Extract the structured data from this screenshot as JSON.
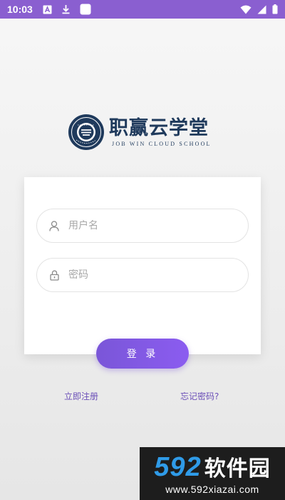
{
  "status_bar": {
    "time": "10:03",
    "left_icons": [
      "app-a-icon",
      "download-icon",
      "white-square-icon"
    ],
    "right_icons": [
      "wifi-icon",
      "signal-icon",
      "battery-icon"
    ]
  },
  "logo": {
    "name_cn": "职赢云学堂",
    "name_en": "JOB WIN CLOUD SCHOOL"
  },
  "form": {
    "username_placeholder": "用户名",
    "password_placeholder": "密码",
    "login_label": "登 录"
  },
  "links": {
    "register": "立即注册",
    "forgot": "忘记密码?"
  },
  "watermark": {
    "num": "592",
    "brand": "软件园",
    "url": "www.592xiazai.com"
  },
  "colors": {
    "status_bar": "#8a5fd0",
    "accent": "#7a56d8",
    "logo_navy": "#1f3a5c",
    "link": "#6b4fb8"
  }
}
